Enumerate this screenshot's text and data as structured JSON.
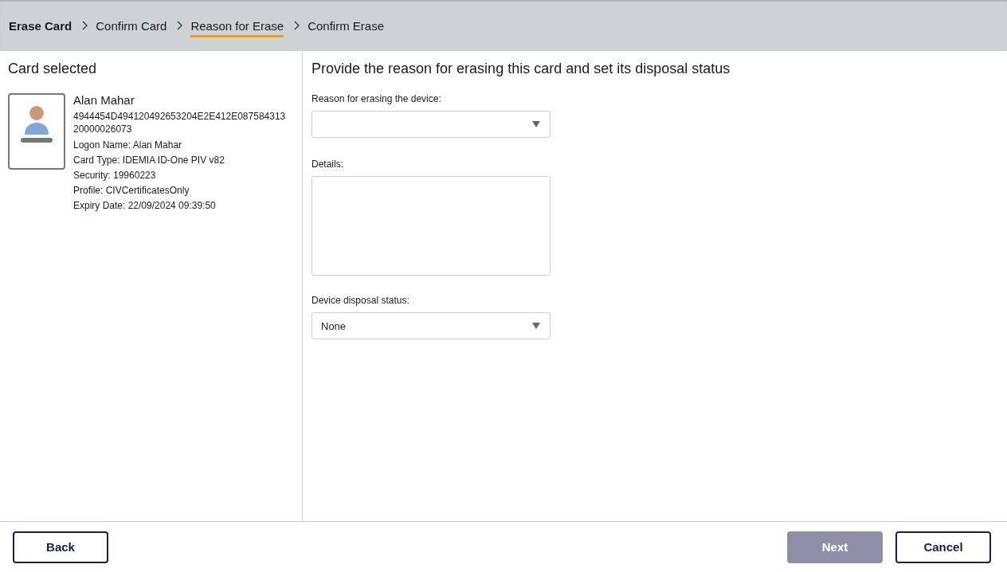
{
  "breadcrumb": [
    {
      "label": "Erase Card",
      "kind": "title",
      "selected": false
    },
    {
      "label": "Confirm Card",
      "kind": "step",
      "selected": false
    },
    {
      "label": "Reason for Erase",
      "kind": "step",
      "selected": true
    },
    {
      "label": "Confirm Erase",
      "kind": "step",
      "selected": false
    }
  ],
  "card_panel": {
    "title": "Card selected",
    "holder_name": "Alan Mahar",
    "card_id": "4944454D494120492653204E2E412E08758431320000026073",
    "details": [
      "Logon Name: Alan Mahar",
      "Card Type: IDEMIA ID-One PIV v82",
      "Security: 19960223",
      "Profile: CIVCertificatesOnly",
      "Expiry Date: 22/09/2024 09:39:50"
    ]
  },
  "form": {
    "title": "Provide the reason for erasing this card and set its disposal status",
    "fields": [
      {
        "kind": "select",
        "label": "Reason for erasing the device:"
      },
      {
        "kind": "textarea",
        "label": "Details:"
      },
      {
        "kind": "select",
        "label": "Device disposal status:",
        "value": "None"
      }
    ]
  },
  "buttons": [
    {
      "label": "Back",
      "disabled": false
    },
    {
      "label": "Next",
      "disabled": true
    },
    {
      "label": "Cancel",
      "disabled": false
    }
  ]
}
